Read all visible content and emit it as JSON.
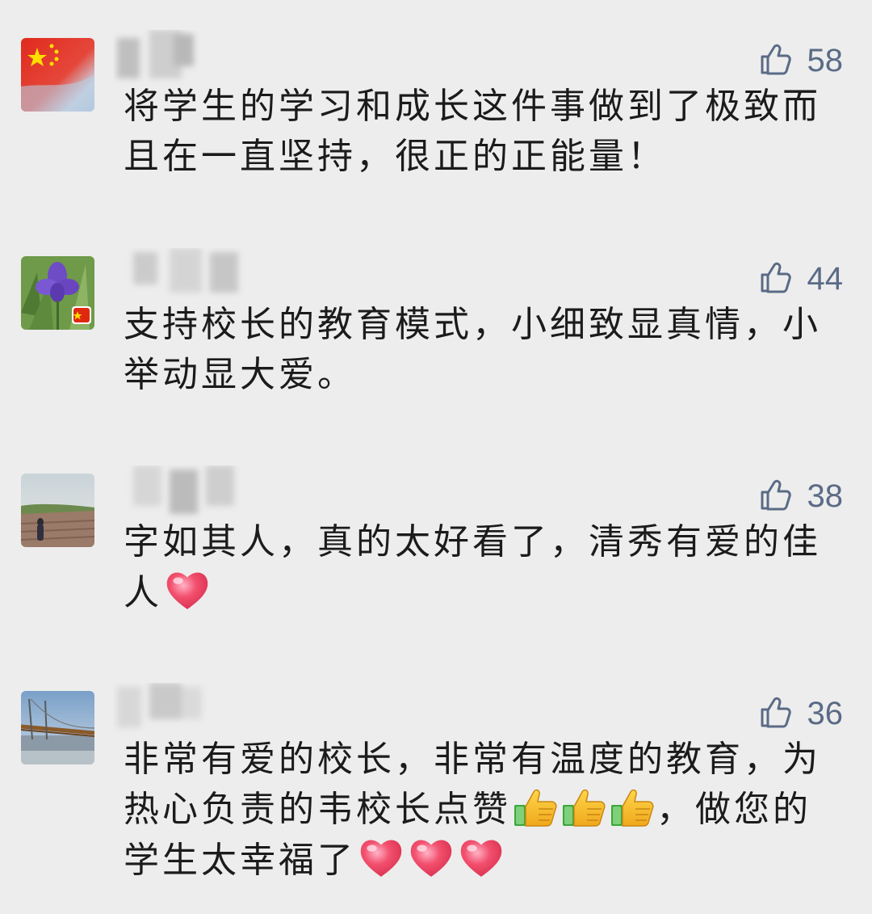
{
  "comments": [
    {
      "likes": "58",
      "avatar": "china-flag-avatar",
      "text": "将学生的学习和成长这件事做到了极致而且在一直坚持，很正的正能量！"
    },
    {
      "likes": "44",
      "avatar": "purple-iris-avatar",
      "text": "支持校长的教育模式，小细致显真情，小举动显大爱。"
    },
    {
      "likes": "38",
      "avatar": "field-landscape-avatar",
      "text_before": "字如其人，真的太好看了，清秀有爱的佳人",
      "emojis": [
        "heart"
      ]
    },
    {
      "likes": "36",
      "avatar": "bridge-river-avatar",
      "text_part1": "非常有爱的校长，非常有温度的教育，为热心负责的韦校长点赞",
      "emojis_mid": [
        "thumbs-up",
        "thumbs-up",
        "thumbs-up"
      ],
      "text_part2": "，做您的学生太幸福了",
      "emojis_end": [
        "heart",
        "heart",
        "heart"
      ]
    }
  ],
  "colors": {
    "background": "#ededed",
    "like_color": "#5a6b86",
    "text_color": "#1b1b1b"
  },
  "icons": {
    "like": "thumb-up-outline-icon",
    "heart": "heart-emoji",
    "thumbs_up": "thumbs-up-emoji"
  }
}
